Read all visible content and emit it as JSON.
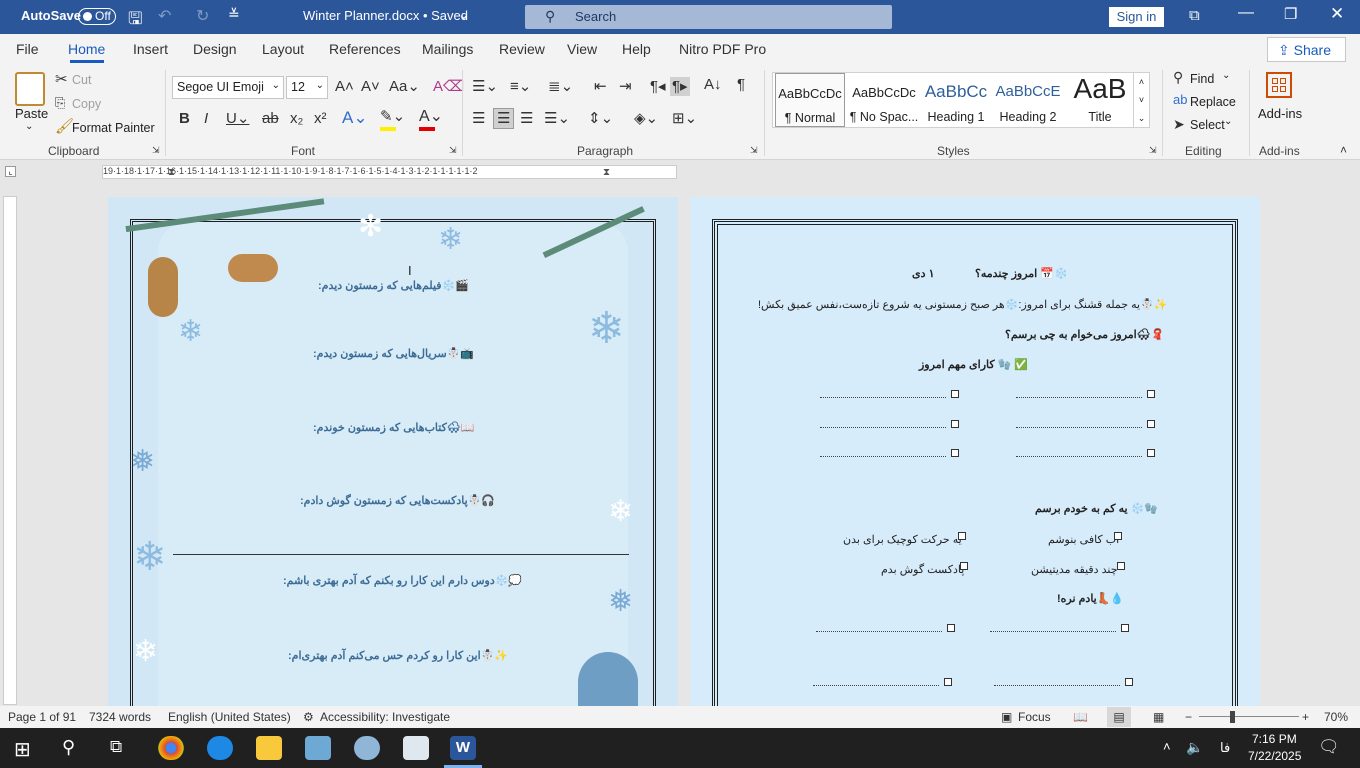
{
  "titlebar": {
    "autosave_label": "AutoSave",
    "autosave_state": "Off",
    "doc_title": "Winter Planner.docx • Saved",
    "search_placeholder": "Search",
    "signin_label": "Sign in"
  },
  "tabs": [
    "File",
    "Home",
    "Insert",
    "Design",
    "Layout",
    "References",
    "Mailings",
    "Review",
    "View",
    "Help",
    "Nitro PDF Pro"
  ],
  "active_tab": "Home",
  "share_label": "Share",
  "ribbon": {
    "clipboard": {
      "paste": "Paste",
      "cut": "Cut",
      "copy": "Copy",
      "format_painter": "Format Painter",
      "group": "Clipboard"
    },
    "font": {
      "name": "Segoe UI Emoji",
      "size": "12",
      "group": "Font"
    },
    "paragraph": {
      "group": "Paragraph"
    },
    "styles": {
      "group": "Styles",
      "items": [
        {
          "preview": "AaBbCcDc",
          "name": "¶ Normal"
        },
        {
          "preview": "AaBbCcDc",
          "name": "¶ No Spac..."
        },
        {
          "preview": "AaBbCc",
          "name": "Heading 1"
        },
        {
          "preview": "AaBbCcE",
          "name": "Heading 2"
        },
        {
          "preview": "AaB",
          "name": "Title"
        }
      ]
    },
    "editing": {
      "find": "Find",
      "replace": "Replace",
      "select": "Select",
      "group": "Editing"
    },
    "addins": {
      "label": "Add-ins",
      "group": "Add-ins"
    }
  },
  "ruler_text": "19·1·18·1·17·1·16·1·15·1·14·1·13·1·12·1·11·1·10·1·9·1·8·1·7·1·6·1·5·1·4·1·3·1·2·1·1·1·1·1·2",
  "page_left": {
    "lines": [
      "🎬❄️فیلم‌هایی که زمستون دیدم:",
      "📺☃️سریال‌هایی که زمستون دیدم:",
      "📖🌨کتاب‌هایی که زمستون خوندم:",
      "🎧☃️پادکست‌هایی که زمستون گوش دادم:",
      "💭❄️دوس دارم این کارا رو بکنم که آدم بهتری باشم:",
      "✨☃️این کارا رو کردم حس می‌کنم آدم بهتری‌ام:"
    ]
  },
  "page_right": {
    "date_q": "❄️📅 امروز چندمه؟",
    "date_val": "۱ دی",
    "sentence": "✨☃️یه جمله قشنگ برای امروز:❄️هر صبح زمستونی یه شروع تازه‌ست،نفس عمیق بکش!",
    "wear": "🧣🌨امروز می‌خوام به چی برسم؟",
    "important": "✅ 🧤 کارای مهم امروز",
    "selfcare": "🧤❄️ یه کم به خودم برسم",
    "task1": "آب کافی بنوشم",
    "task2": "یه حرکت کوچیک برای بدن",
    "task3": "چند دقیقه مدیتیشن",
    "task4": "پادکست گوش بدم",
    "forget": "💧👢یادم نره!"
  },
  "status": {
    "page": "Page 1 of 91",
    "words": "7324 words",
    "language": "English (United States)",
    "accessibility": "Accessibility: Investigate",
    "focus": "Focus",
    "zoom": "70%"
  },
  "taskbar": {
    "time": "7:16 PM",
    "date": "7/22/2025",
    "lang": "فا"
  }
}
